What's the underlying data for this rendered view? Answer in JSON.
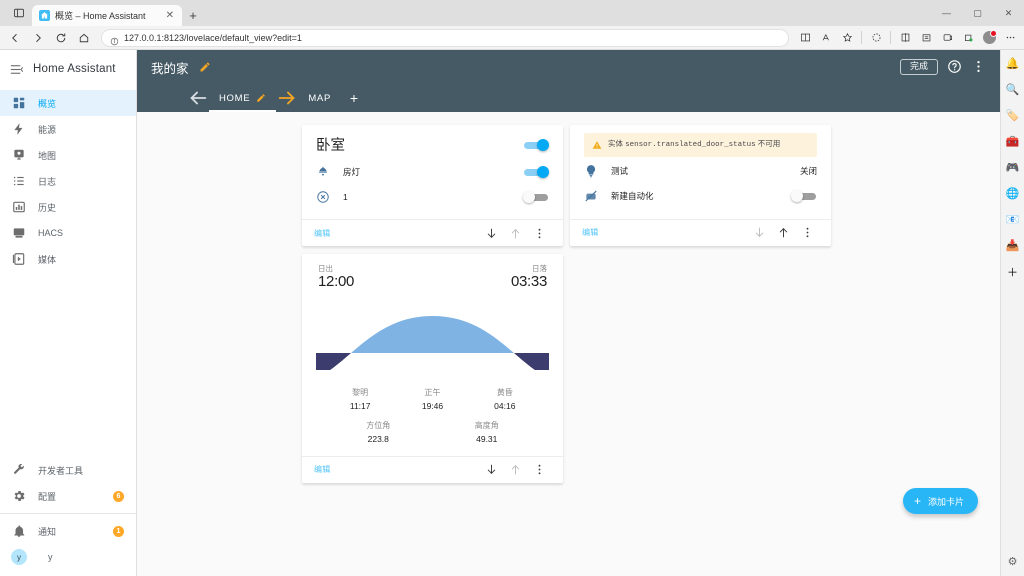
{
  "browser": {
    "tab_title": "概览 – Home Assistant",
    "tab_close": "✕",
    "newtab": "+",
    "url": "127.0.0.1:8123/lovelace/default_view?edit=1",
    "win_minimize": "—",
    "win_maximize": "▢",
    "win_close": "✕"
  },
  "sidebar": {
    "brand": "Home Assistant",
    "items": [
      {
        "label": "概览",
        "icon": "dashboard-icon",
        "active": true
      },
      {
        "label": "能源",
        "icon": "lightning-icon",
        "active": false
      },
      {
        "label": "地图",
        "icon": "map-icon",
        "active": false
      },
      {
        "label": "日志",
        "icon": "logbook-icon",
        "active": false
      },
      {
        "label": "历史",
        "icon": "history-chart-icon",
        "active": false
      },
      {
        "label": "HACS",
        "icon": "hacs-icon",
        "active": false
      },
      {
        "label": "媒体",
        "icon": "media-icon",
        "active": false
      }
    ],
    "bottom_items": [
      {
        "label": "开发者工具",
        "icon": "wrench-icon",
        "badge": ""
      },
      {
        "label": "配置",
        "icon": "gear-icon",
        "badge": "6"
      }
    ],
    "notifications": {
      "label": "通知",
      "icon": "bell-icon",
      "badge": "1"
    },
    "user": {
      "label": "y",
      "initial": "y"
    }
  },
  "header": {
    "title": "我的家",
    "done_label": "完成",
    "tabs": [
      {
        "label": "HOME",
        "selected": true
      },
      {
        "label": "MAP",
        "selected": false
      }
    ],
    "tab_add": "+"
  },
  "cards": [
    {
      "id": "bedroom-card",
      "title": "卧室",
      "header_toggle": "on",
      "rows": [
        {
          "label": "房灯",
          "icon": "ceiling-light-icon",
          "control": "toggle",
          "state": "on"
        },
        {
          "label": "1",
          "icon": "close-circle-icon",
          "control": "toggle",
          "state": "off"
        }
      ],
      "actions": {
        "edit_label": "编辑",
        "move_down_enabled": true,
        "move_up_enabled": false
      }
    },
    {
      "id": "entities-card",
      "warning": {
        "prefix": "实体",
        "entity_id": "sensor.translated_door_status",
        "suffix": "不可用"
      },
      "rows": [
        {
          "label": "测试",
          "icon": "lightbulb-icon",
          "control": "text",
          "state": "关闭"
        },
        {
          "label": "新建自动化",
          "icon": "robot-off-icon",
          "control": "toggle",
          "state": "off"
        }
      ],
      "actions": {
        "edit_label": "编辑",
        "move_down_enabled": false,
        "move_up_enabled": true
      }
    },
    {
      "id": "sun-card",
      "sunrise_label": "日出",
      "sunrise_value": "12:00",
      "sunset_label": "日落",
      "sunset_value": "03:33",
      "details": [
        {
          "label": "黎明",
          "value": "11:17"
        },
        {
          "label": "正午",
          "value": "19:46"
        },
        {
          "label": "黄昏",
          "value": "04:16"
        }
      ],
      "details2": [
        {
          "label": "方位角",
          "value": "223.8"
        },
        {
          "label": "高度角",
          "value": "49.31"
        }
      ],
      "actions": {
        "edit_label": "编辑",
        "move_down_enabled": true,
        "move_up_enabled": false
      }
    }
  ],
  "fab": {
    "label": "添加卡片",
    "plus": "+"
  },
  "colors": {
    "header_bg": "#455a64",
    "accent": "#03a9f4",
    "amber": "#f5a623",
    "warning_bg": "#fdf3dd",
    "sun_above": "#7fb3e3",
    "sun_below": "#3c3c6e",
    "badge": "#ffa726"
  }
}
